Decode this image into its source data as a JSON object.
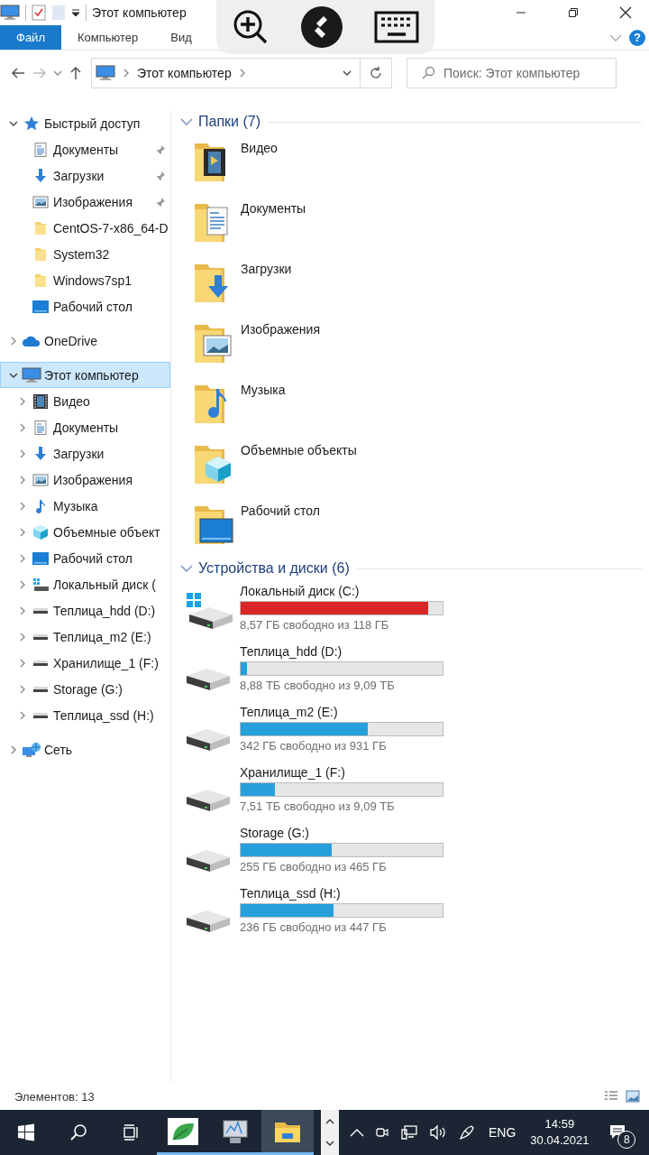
{
  "window": {
    "title": "Этот компьютер"
  },
  "ribbon": {
    "tabs": [
      {
        "label": "Файл",
        "selected": true
      },
      {
        "label": "Компьютер",
        "selected": false
      },
      {
        "label": "Вид",
        "selected": false
      }
    ],
    "help": "?"
  },
  "address": {
    "path": "Этот компьютер",
    "search_placeholder": "Поиск: Этот компьютер"
  },
  "navigation": [
    {
      "label": "Быстрый доступ",
      "kind": "star",
      "expanded": true,
      "selected": false,
      "children": [
        {
          "label": "Документы",
          "kind": "documents",
          "pinned": true,
          "selected": false
        },
        {
          "label": "Загрузки",
          "kind": "downloads",
          "pinned": true,
          "selected": false
        },
        {
          "label": "Изображения",
          "kind": "images",
          "pinned": true,
          "selected": false
        },
        {
          "label": "CentOS-7-x86_64-D",
          "kind": "folder",
          "pinned": false,
          "selected": false
        },
        {
          "label": "System32",
          "kind": "folder",
          "pinned": false,
          "selected": false
        },
        {
          "label": "Windows7sp1",
          "kind": "folder",
          "pinned": false,
          "selected": false
        },
        {
          "label": "Рабочий стол",
          "kind": "desktop",
          "pinned": false,
          "selected": false
        }
      ]
    },
    {
      "label": "OneDrive",
      "kind": "cloud",
      "expanded": false,
      "selected": false
    },
    {
      "label": "Этот компьютер",
      "kind": "computer",
      "expanded": true,
      "selected": true,
      "children": [
        {
          "label": "Видео",
          "kind": "video",
          "expanded": false,
          "selected": false
        },
        {
          "label": "Документы",
          "kind": "documents",
          "expanded": false,
          "selected": false
        },
        {
          "label": "Загрузки",
          "kind": "downloads",
          "expanded": false,
          "selected": false
        },
        {
          "label": "Изображения",
          "kind": "images",
          "expanded": false,
          "selected": false
        },
        {
          "label": "Музыка",
          "kind": "music",
          "expanded": false,
          "selected": false
        },
        {
          "label": "Объемные объект",
          "kind": "objects3d",
          "expanded": false,
          "selected": false
        },
        {
          "label": "Рабочий стол",
          "kind": "desktop",
          "expanded": false,
          "selected": false
        },
        {
          "label": "Локальный диск (",
          "kind": "system_disk",
          "expanded": false,
          "selected": false
        },
        {
          "label": "Теплица_hdd (D:)",
          "kind": "drive",
          "expanded": false,
          "selected": false
        },
        {
          "label": "Теплица_m2 (E:)",
          "kind": "drive",
          "expanded": false,
          "selected": false
        },
        {
          "label": "Хранилище_1 (F:)",
          "kind": "drive",
          "expanded": false,
          "selected": false
        },
        {
          "label": "Storage (G:)",
          "kind": "drive",
          "expanded": false,
          "selected": false
        },
        {
          "label": "Теплица_ssd (H:)",
          "kind": "drive",
          "expanded": false,
          "selected": false
        }
      ]
    },
    {
      "label": "Сеть",
      "kind": "network",
      "expanded": false,
      "selected": false
    }
  ],
  "sections": [
    {
      "title": "Папки (7)",
      "expanded": true,
      "items": [
        {
          "name": "Видео",
          "kind": "video"
        },
        {
          "name": "Документы",
          "kind": "documents"
        },
        {
          "name": "Загрузки",
          "kind": "downloads"
        },
        {
          "name": "Изображения",
          "kind": "images"
        },
        {
          "name": "Музыка",
          "kind": "music"
        },
        {
          "name": "Объемные объекты",
          "kind": "objects3d"
        },
        {
          "name": "Рабочий стол",
          "kind": "desktop"
        }
      ]
    },
    {
      "title": "Устройства и диски (6)",
      "expanded": true,
      "items": [
        {
          "name": "Локальный диск (C:)",
          "kind": "system_disk",
          "level": 0.93,
          "color": "#da2626",
          "free": "8,57 ГБ свободно из 118 ГБ"
        },
        {
          "name": "Теплица_hdd (D:)",
          "kind": "drive",
          "level": 0.03,
          "color": "#26a0da",
          "free": "8,88 ТБ свободно из 9,09 ТБ"
        },
        {
          "name": "Теплица_m2 (E:)",
          "kind": "drive",
          "level": 0.63,
          "color": "#26a0da",
          "free": "342 ГБ свободно из 931 ГБ"
        },
        {
          "name": "Хранилище_1 (F:)",
          "kind": "drive",
          "level": 0.17,
          "color": "#26a0da",
          "free": "7,51 ТБ свободно из 9,09 ТБ"
        },
        {
          "name": "Storage (G:)",
          "kind": "drive",
          "level": 0.45,
          "color": "#26a0da",
          "free": "255 ГБ свободно из 465 ГБ"
        },
        {
          "name": "Теплица_ssd (H:)",
          "kind": "drive",
          "level": 0.46,
          "color": "#26a0da",
          "free": "236 ГБ свободно из 447 ГБ"
        }
      ]
    }
  ],
  "status_bar": {
    "count": "Элементов: 13"
  },
  "taskbar": {
    "apps": [
      {
        "kind": "leaf",
        "selected": false
      },
      {
        "kind": "monitor",
        "selected": false
      },
      {
        "kind": "explorer",
        "selected": true
      }
    ],
    "language": "ENG",
    "time": "14:59",
    "date": "30.04.2021",
    "notifications": "8"
  }
}
